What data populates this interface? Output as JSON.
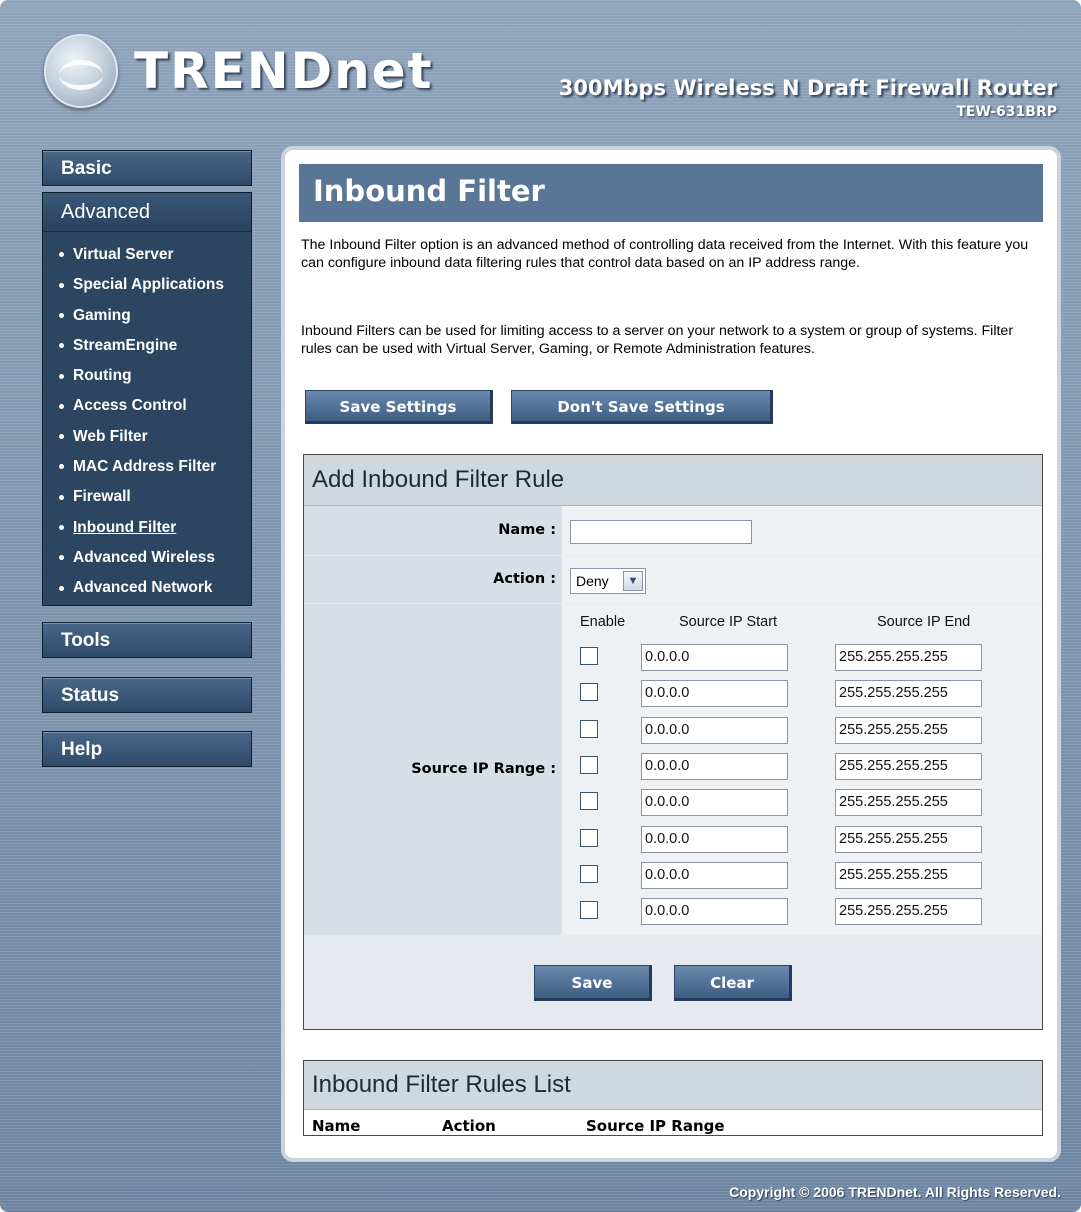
{
  "header": {
    "brand": "TRENDnet",
    "product_title": "300Mbps Wireless N Draft Firewall Router",
    "model": "TEW-631BRP"
  },
  "sidebar": {
    "basic_label": "Basic",
    "advanced_label": "Advanced",
    "advanced_items": [
      {
        "label": "Virtual Server"
      },
      {
        "label": "Special Applications"
      },
      {
        "label": "Gaming"
      },
      {
        "label": "StreamEngine"
      },
      {
        "label": "Routing"
      },
      {
        "label": "Access Control"
      },
      {
        "label": "Web Filter"
      },
      {
        "label": "MAC Address Filter"
      },
      {
        "label": "Firewall"
      },
      {
        "label": "Inbound Filter",
        "active": true
      },
      {
        "label": "Advanced Wireless"
      },
      {
        "label": "Advanced Network"
      }
    ],
    "tools_label": "Tools",
    "status_label": "Status",
    "help_label": "Help"
  },
  "main": {
    "title": "Inbound Filter",
    "description_1": "The Inbound Filter option is an advanced method of controlling data received from the Internet. With this feature you can configure inbound data filtering rules that control data based on an IP address range.",
    "description_2": "Inbound Filters can be used for limiting access to a server on your network to a system or group of systems. Filter rules can be used with Virtual Server, Gaming, or Remote Administration features.",
    "save_settings_label": "Save Settings",
    "dont_save_label": "Don't Save Settings"
  },
  "add_rule": {
    "heading": "Add Inbound Filter Rule",
    "name_label": "Name :",
    "name_value": "",
    "action_label": "Action :",
    "action_value": "Deny",
    "range_label": "Source IP Range :",
    "col_enable": "Enable",
    "col_start": "Source IP Start",
    "col_end": "Source IP End",
    "rows": [
      {
        "enabled": false,
        "start": "0.0.0.0",
        "end": "255.255.255.255"
      },
      {
        "enabled": false,
        "start": "0.0.0.0",
        "end": "255.255.255.255"
      },
      {
        "enabled": false,
        "start": "0.0.0.0",
        "end": "255.255.255.255"
      },
      {
        "enabled": false,
        "start": "0.0.0.0",
        "end": "255.255.255.255"
      },
      {
        "enabled": false,
        "start": "0.0.0.0",
        "end": "255.255.255.255"
      },
      {
        "enabled": false,
        "start": "0.0.0.0",
        "end": "255.255.255.255"
      },
      {
        "enabled": false,
        "start": "0.0.0.0",
        "end": "255.255.255.255"
      },
      {
        "enabled": false,
        "start": "0.0.0.0",
        "end": "255.255.255.255"
      }
    ],
    "save_label": "Save",
    "clear_label": "Clear"
  },
  "rules_list": {
    "heading": "Inbound Filter Rules List",
    "col_name": "Name",
    "col_action": "Action",
    "col_range": "Source IP Range"
  },
  "footer": {
    "copyright": "Copyright © 2006 TRENDnet. All Rights Reserved."
  }
}
